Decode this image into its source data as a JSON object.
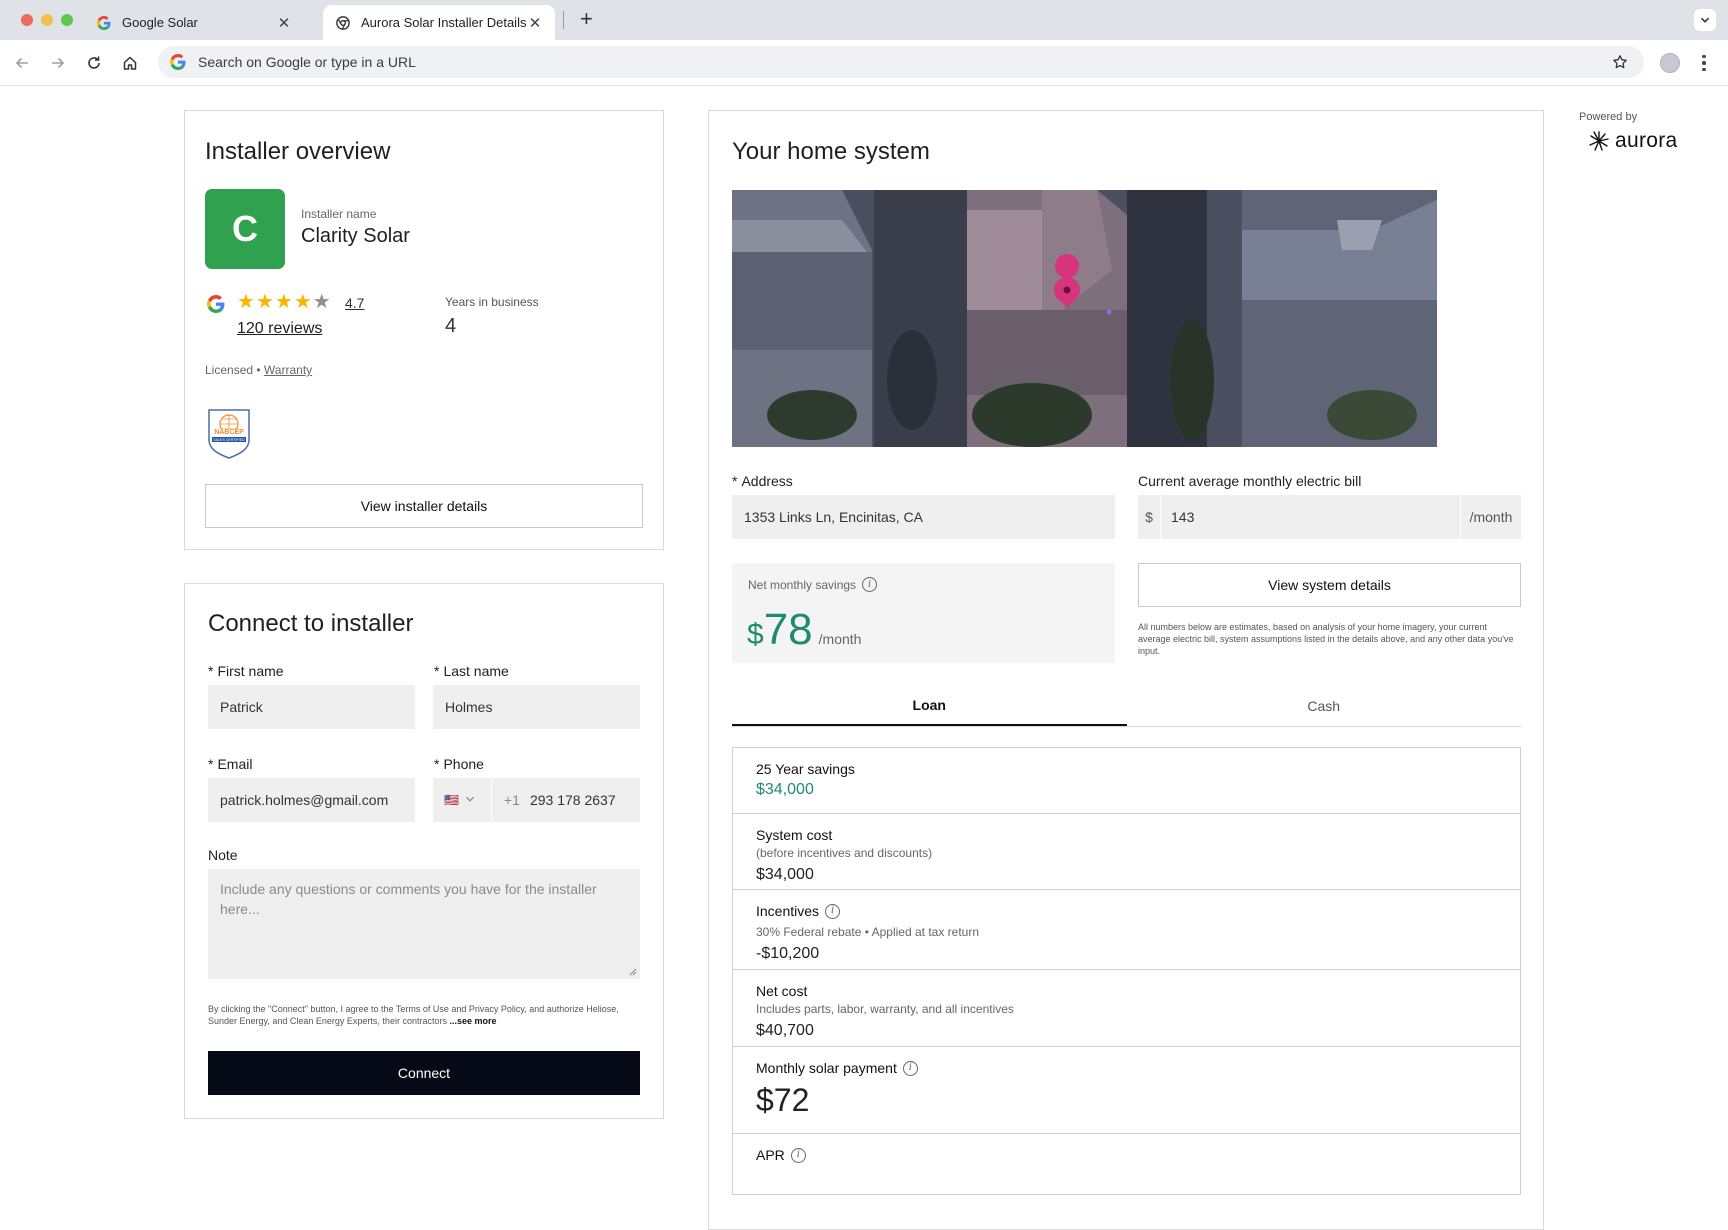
{
  "browser": {
    "tabs": [
      {
        "title": "Google Solar",
        "icon": "google-icon",
        "active": false
      },
      {
        "title": "Aurora Solar Installer Details",
        "icon": "chrome-icon",
        "active": true
      }
    ],
    "omnibox_placeholder": "Search on Google or type in a URL"
  },
  "installer_overview": {
    "heading": "Installer overview",
    "logo_letter": "C",
    "logo_color": "#30a14e",
    "name_label": "Installer name",
    "name": "Clarity Solar",
    "rating": "4.7",
    "rating_value": 4.7,
    "stars_filled": 4,
    "stars_total": 5,
    "reviews": "120 reviews",
    "years_label": "Years in business",
    "years_value": "4",
    "licensed": "Licensed •",
    "warranty_link": "Warranty",
    "badge_text": "NABCEP",
    "badge_subtext": "SALES CERTIFIED",
    "view_details_button": "View installer details"
  },
  "connect": {
    "heading": "Connect to installer",
    "first_name_label": "First name",
    "first_name_value": "Patrick",
    "last_name_label": "Last name",
    "last_name_value": "Holmes",
    "email_label": "Email",
    "email_value": "patrick.holmes@gmail.com",
    "phone_label": "Phone",
    "phone_country_flag": "🇺🇸",
    "phone_code": "+1",
    "phone_value": "293 178 2637",
    "note_label": "Note",
    "note_placeholder": "Include any questions or comments you have for the installer here...",
    "required_mark": "*",
    "legal_text": "By clicking the \"Connect\" button, I agree to the Terms of Use and Privacy Policy, and authorize Heliose, Sunder Energy, and Clean Energy Experts, their contractors",
    "legal_more": "...see more",
    "connect_button": "Connect"
  },
  "home_system": {
    "heading": "Your home system",
    "address_label": "Address",
    "address_value": "1353 Links Ln, Encinitas, CA",
    "bill_label": "Current average monthly electric bill",
    "bill_currency": "$",
    "bill_value": "143",
    "bill_unit": "/month",
    "savings_label": "Net monthly savings",
    "savings_dollar": "$",
    "savings_value": "78",
    "savings_unit": "/month",
    "view_system_button": "View system details",
    "estimate_note": "All numbers below are estimates, based on analysis of your home imagery, your current average electric bill, system assumptions listed in the details above, and any other data you've input.",
    "tabs": [
      "Loan",
      "Cash"
    ],
    "active_tab": "Loan",
    "accent_color": "#1d8c6c",
    "loan_rows": [
      {
        "title": "25 Year savings",
        "value": "$34,000"
      },
      {
        "title": "System cost",
        "subtitle": "(before incentives and discounts)",
        "value": "$34,000"
      },
      {
        "title": "Incentives",
        "subtitle": "30% Federal rebate • Applied at tax return",
        "value": "-$10,200"
      },
      {
        "title": "Net cost",
        "subtitle": "Includes parts, labor, warranty, and all incentives",
        "value": "$40,700"
      },
      {
        "title": "Monthly solar payment",
        "value": "$72"
      },
      {
        "title": "APR"
      }
    ]
  },
  "branding": {
    "powered_by": "Powered by",
    "brand": "aurora"
  }
}
